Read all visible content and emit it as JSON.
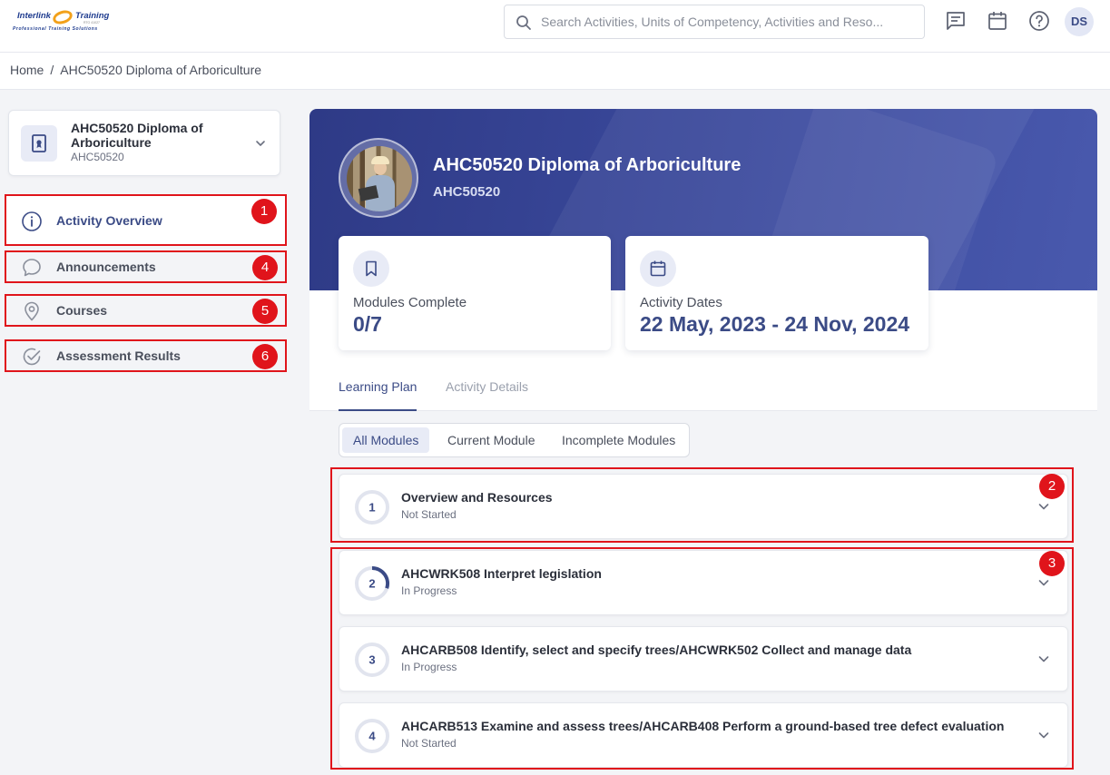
{
  "header": {
    "logo": {
      "line1_left": "Interlink",
      "line1_right": "Training",
      "tagline": "Professional Training Solutions",
      "small": "RTO 41027"
    },
    "search_placeholder": "Search Activities, Units of Competency, Activities and Reso...",
    "user_initials": "DS"
  },
  "breadcrumb": {
    "home": "Home",
    "separator": "/",
    "current": "AHC50520 Diploma of Arboriculture"
  },
  "sidebar": {
    "course_title": "AHC50520 Diploma of Arboriculture",
    "course_code": "AHC50520",
    "items": [
      {
        "label": "Activity Overview",
        "icon": "info-icon",
        "badge": "1",
        "active": true
      },
      {
        "label": "Announcements",
        "icon": "chat-icon",
        "badge": "4",
        "active": false
      },
      {
        "label": "Courses",
        "icon": "location-pin-icon",
        "badge": "5",
        "active": false
      },
      {
        "label": "Assessment Results",
        "icon": "check-circle-icon",
        "badge": "6",
        "active": false
      }
    ]
  },
  "hero": {
    "title": "AHC50520 Diploma of Arboriculture",
    "code": "AHC50520",
    "stats": [
      {
        "label": "Modules Complete",
        "value": "0/7",
        "icon": "bookmark-icon"
      },
      {
        "label": "Activity Dates",
        "value": "22 May, 2023 - 24 Nov, 2024",
        "icon": "calendar-icon"
      }
    ]
  },
  "tabs": [
    {
      "label": "Learning Plan",
      "active": true
    },
    {
      "label": "Activity Details",
      "active": false
    }
  ],
  "filters": [
    {
      "label": "All Modules",
      "active": true
    },
    {
      "label": "Current Module",
      "active": false
    },
    {
      "label": "Incomplete Modules",
      "active": false
    }
  ],
  "modules": [
    {
      "number": "1",
      "name": "Overview and Resources",
      "status": "Not Started",
      "progress": 0
    },
    {
      "number": "2",
      "name": "AHCWRK508 Interpret legislation",
      "status": "In Progress",
      "progress": 0.3
    },
    {
      "number": "3",
      "name": "AHCARB508 Identify, select and specify trees/AHCWRK502 Collect and manage data",
      "status": "In Progress",
      "progress": 0
    },
    {
      "number": "4",
      "name": "AHCARB513 Examine and assess trees/AHCARB408 Perform a ground-based tree defect evaluation",
      "status": "Not Started",
      "progress": 0
    }
  ],
  "annotations": {
    "module_group_1": "2",
    "module_group_2": "3"
  },
  "colors": {
    "accent": "#3b4b86",
    "hero": "#3d4ca0",
    "annotation_red": "#e0141b"
  }
}
